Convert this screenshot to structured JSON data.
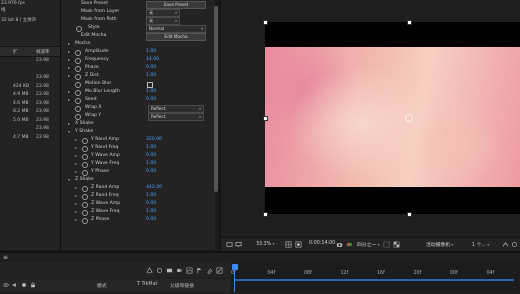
{
  "project": {
    "info_line1": "23.976 fps",
    "info_line2": "32 bit 8 / 立体声",
    "info_line3": "线",
    "col_ext": "扩",
    "col_rate": "帧速率",
    "rows": [
      {
        "ext": "",
        "size": "",
        "rate": "23.98"
      },
      {
        "ext": "",
        "size": "",
        "rate": ""
      },
      {
        "ext": "",
        "size": "",
        "rate": "23.98"
      },
      {
        "ext": "",
        "size": "424 KB",
        "rate": "23.98"
      },
      {
        "ext": "",
        "size": "4.9 MB",
        "rate": "23.98"
      },
      {
        "ext": "",
        "size": "4.6 MB",
        "rate": "23.98"
      },
      {
        "ext": "",
        "size": "8.2 MB",
        "rate": "23.98"
      },
      {
        "ext": "",
        "size": "5.0 MB",
        "rate": "23.98"
      },
      {
        "ext": "",
        "size": "",
        "rate": "23.98"
      },
      {
        "ext": "",
        "size": "4.7 MB",
        "rate": "23.98"
      }
    ]
  },
  "effects": {
    "save_preset_label": "Save Preset",
    "save_preset_button": "Save Preset",
    "mask_from_layer": "Mask from Layer",
    "mask_from_layer_value": "无",
    "mask_from_path": "Mask from Path",
    "mask_from_path_value": "无",
    "style_label": "Style",
    "style_value": "Normal",
    "edit_mocha_label": "Edit Mocha",
    "edit_mocha_button": "Edit Mocha",
    "mocha_group": "Mocha",
    "amplitude": {
      "label": "Amplitude",
      "value": "1.00"
    },
    "frequency": {
      "label": "Frequency",
      "value": "14.00"
    },
    "phase": {
      "label": "Phase",
      "value": "0.00"
    },
    "z_dist": {
      "label": "Z Dist",
      "value": "1.00"
    },
    "motion_blur": {
      "label": "Motion Blur"
    },
    "mo_blur_length": {
      "label": "Mo Blur Length",
      "value": "1.00"
    },
    "seed": {
      "label": "Seed",
      "value": "0.00"
    },
    "wrap_x": {
      "label": "Wrap X",
      "value": "Reflect"
    },
    "wrap_y": {
      "label": "Wrap Y",
      "value": "Reflect"
    },
    "x_shake": "X Shake",
    "y_shake": "Y Shake",
    "y_rand_amp": {
      "label": "Y Rand Amp",
      "value": "320.00"
    },
    "y_rand_freq": {
      "label": "Y Rand Freq",
      "value": "1.00"
    },
    "y_wave_amp": {
      "label": "Y Wave Amp",
      "value": "0.00"
    },
    "y_wave_freq": {
      "label": "Y Wave Freq",
      "value": "1.00"
    },
    "y_phase": {
      "label": "Y Phase",
      "value": "0.00"
    },
    "z_shake": "Z Shake",
    "z_rand_amp": {
      "label": "Z Rand Amp",
      "value": "442.00"
    },
    "z_rand_freq": {
      "label": "Z Rand Freq",
      "value": "1.00"
    },
    "z_wave_amp": {
      "label": "Z Wave Amp",
      "value": "0.00"
    },
    "z_wave_freq": {
      "label": "Z Wave Freq",
      "value": "1.00"
    },
    "z_phase": {
      "label": "Z Phase",
      "value": "0.00"
    }
  },
  "viewer": {
    "zoom": "33.3%",
    "timecode": "0:00:14:00",
    "resolution": "四分之一",
    "camera": "活动摄像机",
    "views": "1 个..."
  },
  "timeline": {
    "tab_label": "≡",
    "col_mode": "模式",
    "col_trkmat": "T  TrkMat",
    "col_parent": "父级和链接",
    "ticks": [
      "0f",
      "04f",
      "08f",
      "12f",
      "16f",
      "20f",
      "00f",
      "04f"
    ]
  },
  "colors": {
    "accent": "#4ea1ff",
    "playhead": "#3d8bff",
    "panel": "#232323"
  }
}
